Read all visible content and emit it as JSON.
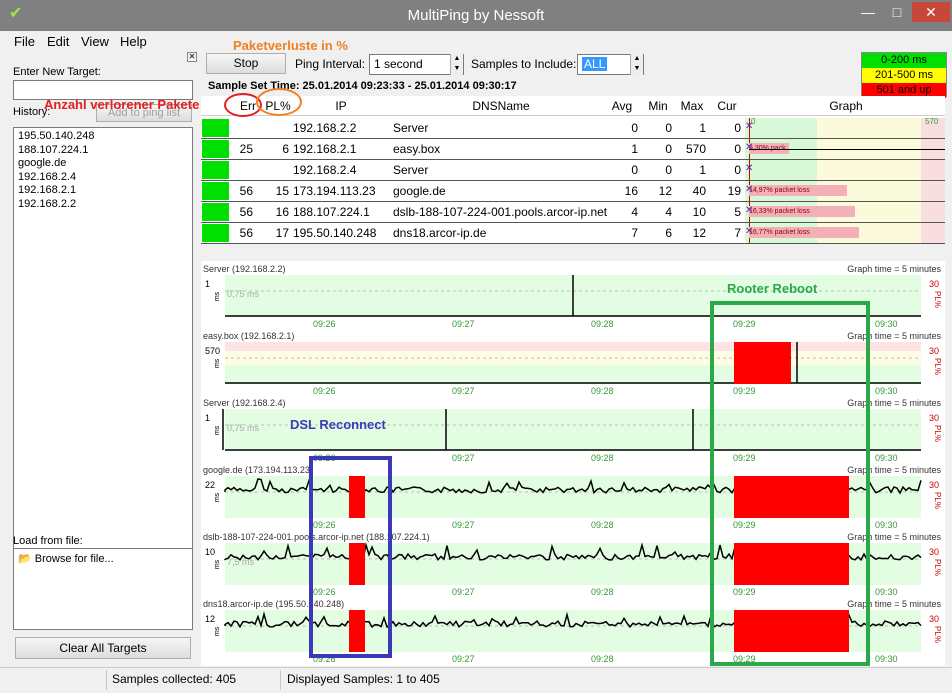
{
  "window": {
    "title": "MultiPing by Nessoft"
  },
  "menu": {
    "file": "File",
    "edit": "Edit",
    "view": "View",
    "help": "Help"
  },
  "left": {
    "enter_target_label": "Enter New Target:",
    "history_label": "History:",
    "add_button": "Add to ping list",
    "history": [
      "195.50.140.248",
      "188.107.224.1",
      "google.de",
      "192.168.2.4",
      "192.168.2.1",
      "192.168.2.2"
    ],
    "load_label": "Load from file:",
    "browse": "Browse for file...",
    "clear_button": "Clear All Targets"
  },
  "toolbar": {
    "stop": "Stop",
    "ping_interval_label": "Ping Interval:",
    "ping_interval_value": "1 second",
    "samples_label": "Samples to Include:",
    "samples_value": "ALL",
    "sample_set": "Sample Set Time: 25.01.2014 09:23:33 - 25.01.2014 09:30:17"
  },
  "legend": [
    {
      "label": "0-200 ms",
      "color": "#00e000"
    },
    {
      "label": "201-500 ms",
      "color": "#ffff00"
    },
    {
      "label": "501 and up",
      "color": "#ff0000"
    }
  ],
  "table": {
    "headers": {
      "err": "Err",
      "pl": "PL%",
      "ip": "IP",
      "dns": "DNSName",
      "avg": "Avg",
      "min": "Min",
      "max": "Max",
      "cur": "Cur",
      "graph": "Graph"
    },
    "graph_scale": {
      "low": "0",
      "high": "570"
    },
    "rows": [
      {
        "err": "",
        "pl": "",
        "ip": "192.168.2.2",
        "dns": "Server",
        "avg": "0",
        "min": "0",
        "max": "1",
        "cur": "0",
        "loss": "",
        "loss_frac": 0
      },
      {
        "err": "25",
        "pl": "6",
        "ip": "192.168.2.1",
        "dns": "easy.box",
        "avg": "1",
        "min": "0",
        "max": "570",
        "cur": "0",
        "loss": "6,30% pack",
        "loss_frac": 0.2
      },
      {
        "err": "",
        "pl": "",
        "ip": "192.168.2.4",
        "dns": "Server",
        "avg": "0",
        "min": "0",
        "max": "1",
        "cur": "0",
        "loss": "",
        "loss_frac": 0
      },
      {
        "err": "56",
        "pl": "15",
        "ip": "173.194.113.23",
        "dns": "google.de",
        "avg": "16",
        "min": "12",
        "max": "40",
        "cur": "19",
        "loss": "14,97% packet loss",
        "loss_frac": 0.49
      },
      {
        "err": "56",
        "pl": "16",
        "ip": "188.107.224.1",
        "dns": "dslb-188-107-224-001.pools.arcor-ip.net",
        "avg": "4",
        "min": "4",
        "max": "10",
        "cur": "5",
        "loss": "16,33% packet loss",
        "loss_frac": 0.53
      },
      {
        "err": "56",
        "pl": "17",
        "ip": "195.50.140.248",
        "dns": "dns18.arcor-ip.de",
        "avg": "7",
        "min": "6",
        "max": "12",
        "cur": "7",
        "loss": "16,77% packet loss",
        "loss_frac": 0.55
      }
    ]
  },
  "charts": {
    "graph_time": "Graph time = 5 minutes",
    "ms": "ms",
    "pl": "PL%",
    "pl_max": "30",
    "x_ticks": [
      "09:26",
      "09:27",
      "09:28",
      "09:29",
      "09:30"
    ],
    "items": [
      {
        "name": "Server (192.168.2.2)",
        "ymax": "1",
        "avg_label": "0,75 ms"
      },
      {
        "name": "easy.box (192.168.2.1)",
        "ymax": "570",
        "avg_label": ""
      },
      {
        "name": "Server (192.168.2.4)",
        "ymax": "1",
        "avg_label": "0,75 ms"
      },
      {
        "name": "google.de (173.194.113.23)",
        "ymax": "22",
        "avg_label": ""
      },
      {
        "name": "dslb-188-107-224-001.pools.arcor-ip.net (188.107.224.1)",
        "ymax": "10",
        "avg_label": "7,5 ms"
      },
      {
        "name": "dns18.arcor-ip.de (195.50.140.248)",
        "ymax": "12",
        "avg_label": ""
      }
    ]
  },
  "status": {
    "collected": "Samples collected: 405",
    "displayed": "Displayed Samples: 1 to 405"
  },
  "annotations": {
    "paketverluste": "Paketverluste in %",
    "anzahl": "Anzahl verlorener Pakete",
    "rooter": "Rooter Reboot",
    "dsl": "DSL Reconnect",
    "colors": {
      "red": "#e02020",
      "orange": "#f08020",
      "green": "#2aa84a",
      "blue": "#3a3ab8"
    }
  }
}
